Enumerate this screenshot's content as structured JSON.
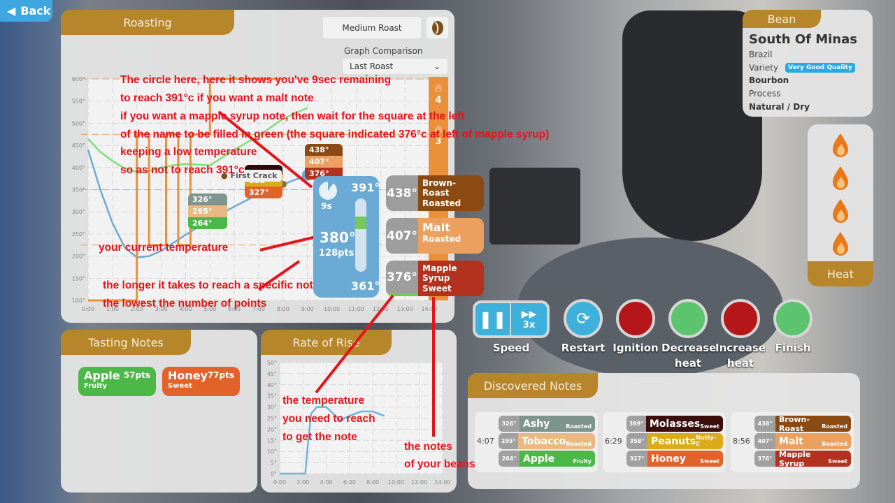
{
  "back_label": "Back",
  "roasting": {
    "title": "Roasting",
    "roast_level": "Medium Roast",
    "comparison_label": "Graph Comparison",
    "comparison_value": "Last Roast",
    "first_crack": "First Crack",
    "heat_markers": [
      "4",
      "3"
    ],
    "stage_boxes": [
      [
        "326°",
        "295°",
        "264°"
      ],
      [
        "358°",
        "327°"
      ],
      [
        "438°",
        "407°",
        "376°"
      ]
    ],
    "current": {
      "timer": "9s",
      "timer_fraction": 0.9,
      "target": "391°",
      "temp": "380°",
      "points": "128pts",
      "min": "361°"
    },
    "upcoming_notes": [
      {
        "temp": "438°",
        "name": "Brown-Roast",
        "type": "Roasted",
        "color": "#8a4a12"
      },
      {
        "temp": "407°",
        "name": "Malt",
        "type": "Roasted",
        "color": "#eba060"
      },
      {
        "temp": "376°",
        "name": "Mapple Syrup",
        "type": "Sweet",
        "color": "#b3321f"
      }
    ]
  },
  "chart_data": [
    {
      "type": "line",
      "title": "Roasting",
      "ylim": [
        100,
        600
      ],
      "xlim": [
        0,
        14
      ],
      "yticks": [
        "600°",
        "550°",
        "500°",
        "450°",
        "400°",
        "350°",
        "300°",
        "250°",
        "200°",
        "150°",
        "100°"
      ],
      "xticks": [
        "0:00",
        "1:00",
        "2:00",
        "3:00",
        "4:00",
        "5:00",
        "6:00",
        "7:00",
        "8:00",
        "9:00",
        "10:00",
        "11:00",
        "12:00",
        "13:00",
        "14:00"
      ],
      "series": [
        {
          "x": [
            0,
            0.5,
            1,
            1.5,
            2,
            2.5,
            3,
            4,
            5,
            6,
            7,
            8,
            9
          ],
          "y": [
            440,
            350,
            275,
            220,
            197,
            200,
            212,
            248,
            282,
            312,
            340,
            362,
            383
          ],
          "color": "#6fa9d2"
        },
        {
          "x": [
            0,
            0.5,
            1,
            1.5,
            2,
            2.5,
            3,
            3.5,
            4,
            5,
            6,
            7,
            8,
            9
          ],
          "y": [
            465,
            435,
            415,
            398,
            390,
            392,
            400,
            405,
            408,
            405,
            440,
            472,
            510,
            535
          ],
          "color": "#7ee07a"
        },
        {
          "x": [
            0,
            2,
            2,
            2.5,
            2.5,
            3.2,
            3.2,
            3.7,
            3.7,
            4.2,
            4.2,
            5,
            5,
            8
          ],
          "y": [
            100,
            100,
            475,
            475,
            225,
            225,
            475,
            475,
            225,
            225,
            475,
            475,
            600,
            600
          ],
          "color": "#e8903a"
        }
      ],
      "heat_thresholds": [
        600,
        475,
        350,
        225
      ]
    },
    {
      "type": "line",
      "title": "Rate of Rise",
      "ylim": [
        0,
        50
      ],
      "xlim": [
        0,
        14
      ],
      "yticks": [
        "50°",
        "45°",
        "40°",
        "35°",
        "30°",
        "25°",
        "20°",
        "15°",
        "10°",
        "5°",
        "0°"
      ],
      "xticks": [
        "0:00",
        "2:00",
        "4:00",
        "6:00",
        "8:00",
        "10:00",
        "12:00",
        "14:00"
      ],
      "series": [
        {
          "x": [
            0,
            2.2,
            2.4,
            2.7,
            3.2,
            4,
            4.6,
            5.2,
            6,
            7,
            8,
            9
          ],
          "y": [
            0,
            0,
            12,
            27,
            30,
            30,
            27,
            24,
            26,
            28,
            28,
            26
          ],
          "color": "#6fb6d6"
        }
      ]
    }
  ],
  "tasting": {
    "title": "Tasting Notes",
    "notes": [
      {
        "name": "Apple",
        "pts": "57pts",
        "type": "Fruity",
        "color": "#4cb848"
      },
      {
        "name": "Honey",
        "pts": "77pts",
        "type": "Sweet",
        "color": "#e2632a"
      }
    ]
  },
  "controls": {
    "speed": "Speed",
    "speed_mult": "3x",
    "restart": "Restart",
    "ignition": "Ignition",
    "decrease": "Decrease heat",
    "increase": "Increase heat",
    "finish": "Finish"
  },
  "discovered": {
    "title": "Discovered Notes",
    "groups": [
      {
        "time": "4:07",
        "notes": [
          {
            "temp": "326°",
            "name": "Ashy",
            "type": "Roasted",
            "color": "#7e948c"
          },
          {
            "temp": "295°",
            "name": "Tobacco",
            "type": "Roasted",
            "color": "#e9b883"
          },
          {
            "temp": "264°",
            "name": "Apple",
            "type": "Fruity",
            "color": "#4cb848"
          }
        ]
      },
      {
        "time": "6:29",
        "notes": [
          {
            "temp": "389°",
            "name": "Molasses",
            "type": "Sweet",
            "color": "#3a0c0c"
          },
          {
            "temp": "358°",
            "name": "Peanuts",
            "type": "Nutty-C",
            "color": "#d9ac1c"
          },
          {
            "temp": "327°",
            "name": "Honey",
            "type": "Sweet",
            "color": "#e2632a"
          }
        ]
      },
      {
        "time": "8:56",
        "notes": [
          {
            "temp": "438°",
            "name": "Brown-Roast",
            "type": "Roasted",
            "color": "#8a4a12"
          },
          {
            "temp": "407°",
            "name": "Malt",
            "type": "Roasted",
            "color": "#eba060"
          },
          {
            "temp": "376°",
            "name": "Mapple Syrup",
            "type": "Sweet",
            "color": "#b3321f"
          }
        ]
      }
    ]
  },
  "bean": {
    "title": "Bean",
    "name": "South Of Minas",
    "origin": "Brazil",
    "variety_label": "Variety",
    "quality": "Very Good Quality",
    "variety": "Bourbon",
    "process_label": "Process",
    "process": "Natural / Dry"
  },
  "heat": {
    "label": "Heat",
    "level": 4
  },
  "annotations": {
    "a1": "The circle here, here it shows you've 9sec remaining",
    "a2": "to reach 391°c if you want a malt note",
    "a3": "if you want a mapple syrup note, then wait for the square at the left",
    "a4": "of the name to be filled in green (the square indicated 376°c at left of mapple syrup)",
    "a5": "keeping a low temperature",
    "a6": "so as not to reach 391°c",
    "a7": "your current temperature",
    "a8": "the longer it takes to reach a specific note",
    "a9": "the lowest the number of points",
    "a10": "the temperature",
    "a11": "you need to reach",
    "a12": "to get the note",
    "a13": "the notes",
    "a14": "of your beans"
  }
}
